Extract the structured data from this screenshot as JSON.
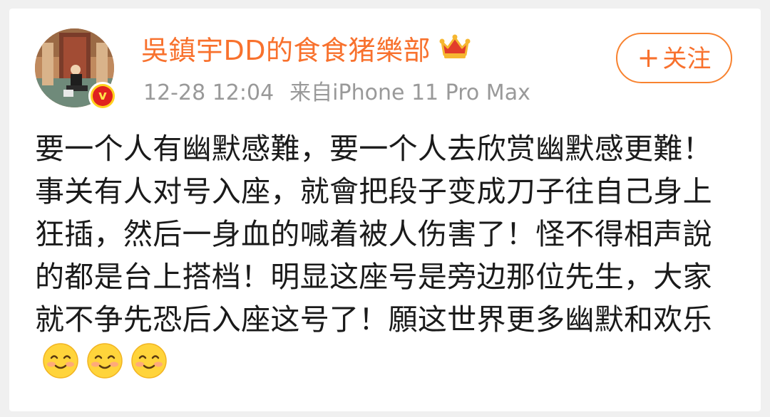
{
  "post": {
    "author": {
      "name": "吳鎮宇DD的食食猪樂部",
      "verified_badge": "verified-v-icon",
      "crown_icon": "crown-icon"
    },
    "timestamp": "12-28 12:04",
    "source": "来自iPhone 11 Pro Max",
    "follow_button": {
      "plus": "+",
      "label": "关注"
    },
    "text": "要一个人有幽默感難，要一个人去欣赏幽默感更難！事关有人对号入座，就會把段子变成刀子往自己身上狂插，然后一身血的喊着被人伤害了！怪不得相声說的都是台上搭档！明显这座号是旁边那位先生，大家就不争先恐后入座这号了！願这世界更多幽默和欢乐",
    "emojis": [
      "smile-emoji",
      "smile-emoji",
      "smile-emoji"
    ]
  },
  "colors": {
    "accent": "#f8712d",
    "meta_text": "#999999",
    "body_text": "#1a1a1a",
    "background": "#ffffff"
  }
}
